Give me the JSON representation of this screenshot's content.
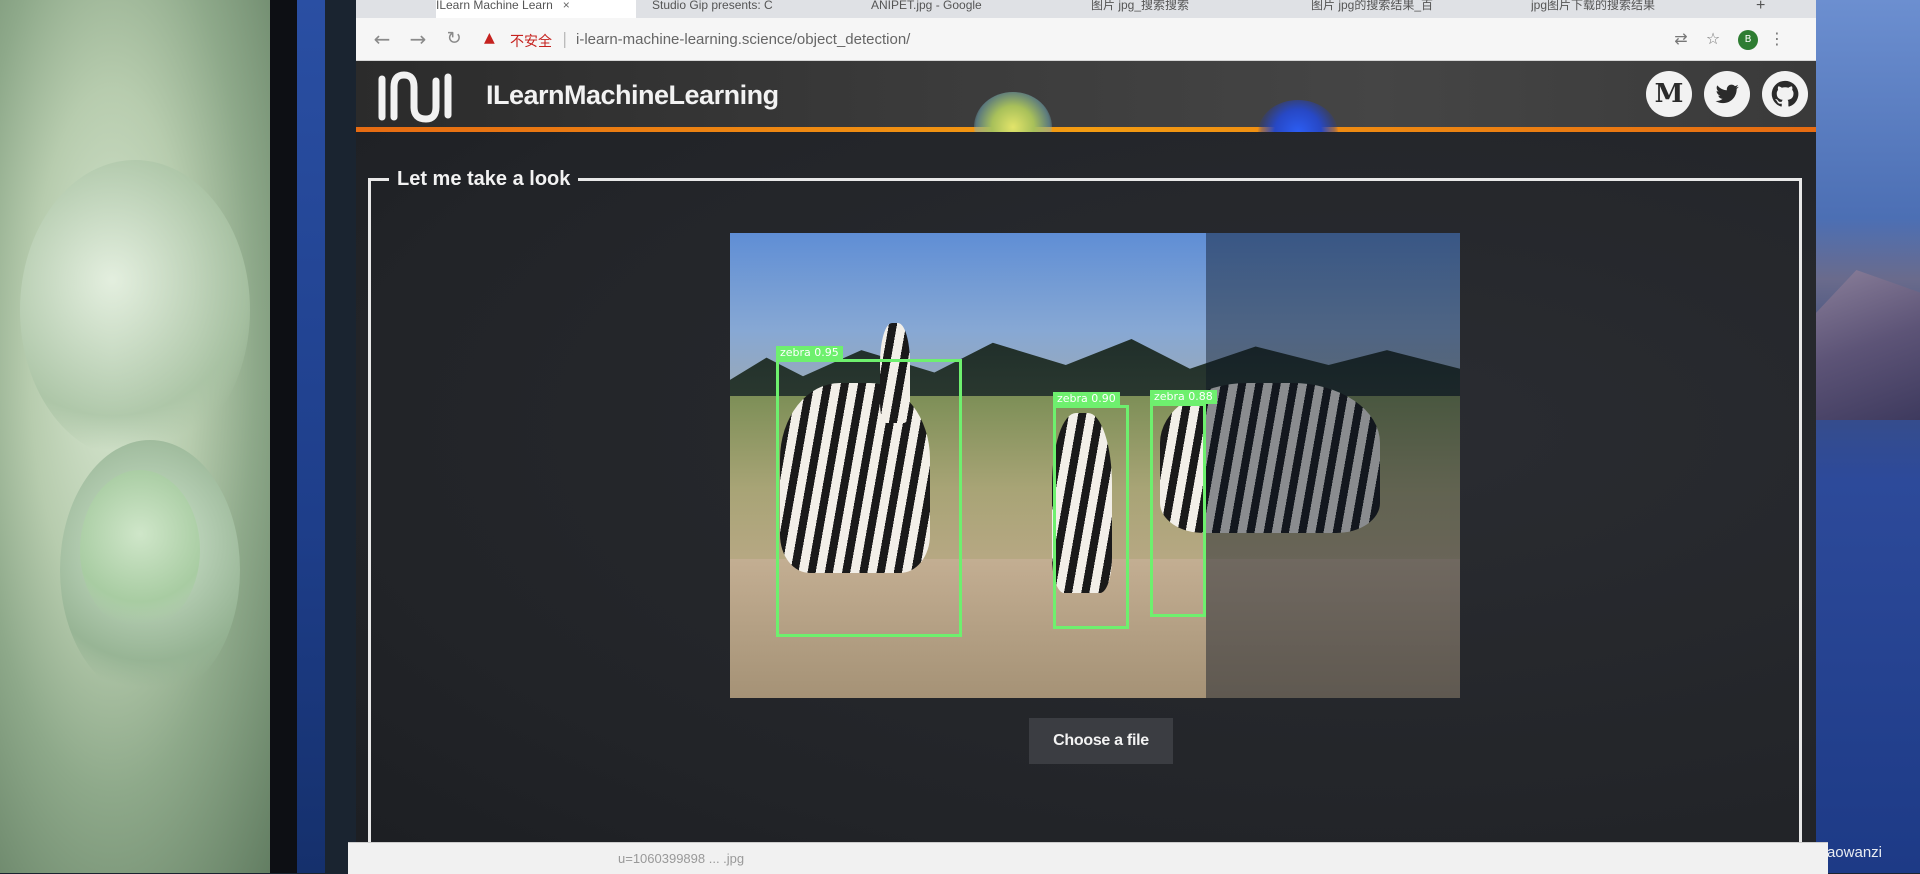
{
  "browser": {
    "tabs": [
      {
        "title": "ILearn Machine Learn",
        "active": true
      },
      {
        "title": "Studio Gip presents: C",
        "active": false
      },
      {
        "title": "ANIPET.jpg - Google",
        "active": false
      },
      {
        "title": "图片 jpg_搜索搜索",
        "active": false
      },
      {
        "title": "图片 jpg的搜索结果_百",
        "active": false
      },
      {
        "title": "jpg图片下载的搜索结果",
        "active": false
      }
    ],
    "insecure_label": "不安全",
    "url": "i-learn-machine-learning.science/object_detection/",
    "profile_initial": "B"
  },
  "site": {
    "brand": "ILearnMachineLearning",
    "social": {
      "medium": "M"
    },
    "section_title": "Let me take a look",
    "choose_file": "Choose a file",
    "detections": [
      {
        "label": "zebra 0.95"
      },
      {
        "label": "zebra 0.90"
      },
      {
        "label": "zebra 0.88"
      }
    ]
  },
  "downloads": [
    {
      "name": "u=1060399898 ... .jpg"
    }
  ],
  "credit": "https://blog.csdn.net/laozaoxiaowanzi"
}
